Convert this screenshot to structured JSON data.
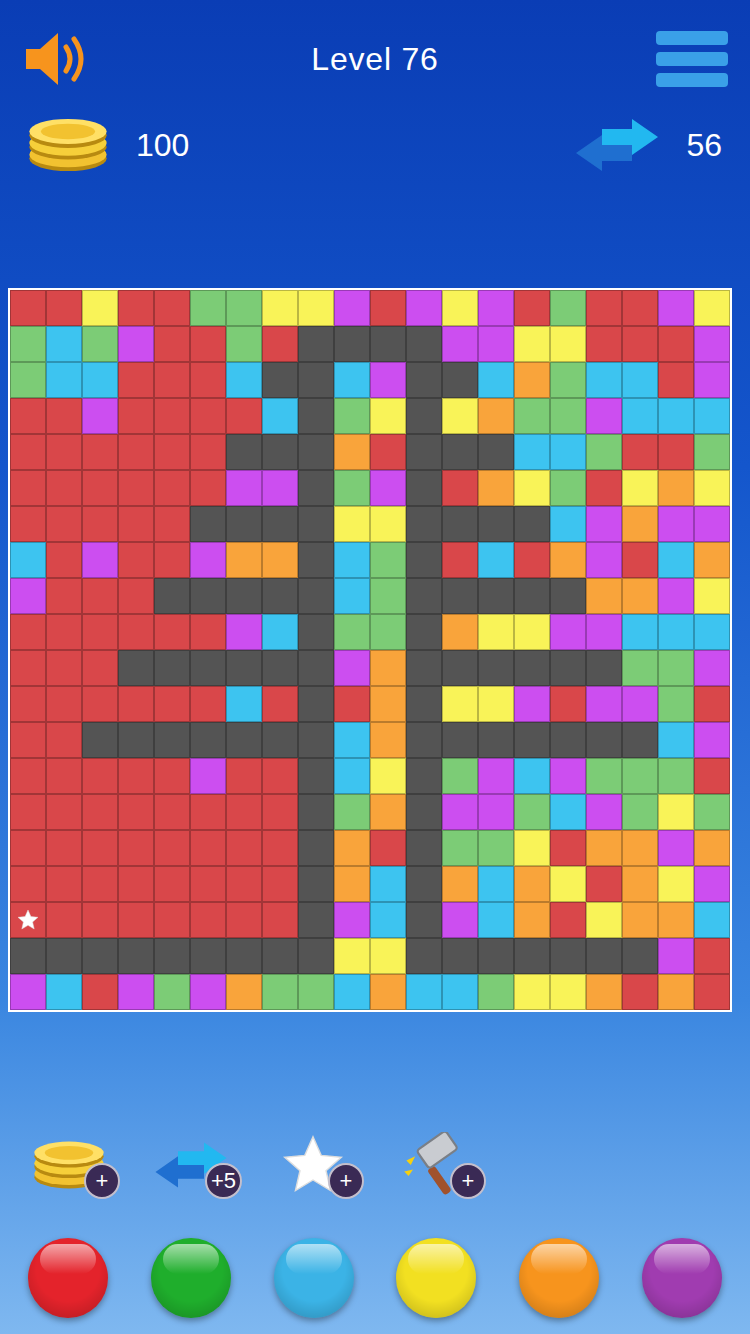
{
  "header": {
    "title": "Level 76",
    "coins": "100",
    "moves": "56"
  },
  "board": {
    "palette": [
      {
        "code": "R",
        "color": "#d9474a"
      },
      {
        "code": "G",
        "color": "#7ccc76"
      },
      {
        "code": "B",
        "color": "#3dc4f0"
      },
      {
        "code": "Y",
        "color": "#f9f358"
      },
      {
        "code": "O",
        "color": "#f9a43b"
      },
      {
        "code": "P",
        "color": "#cc4ef0"
      },
      {
        "code": "K",
        "color": "#545454"
      }
    ],
    "rows": [
      "RRYRRGGYYPRPYPRGRRPY",
      "GBGPRRGRKKKKPPYYRRRP",
      "GBBRRRBKKBPKKBOGBBRP",
      "RRPRRRRBKGYKYOGGPBBB",
      "RRRRRRKKKORKKKBBGRRG",
      "RRRRRRPPKGPKROYGRYOY",
      "RRRRRKKKKYYKKKKBPOPP",
      "BRPRRPOOKBGKRBROPRBO",
      "PRRRKKKKKBGKKKKKOOPY",
      "RRRRRRPBKGGKOYYPPBBB",
      "RRRKKKKKKPOKKKKKKGGP",
      "RRRRRRBRKROKYYPRPPGR",
      "RRKKKKKKKBOKKKKKKKBP",
      "RRRRRPRRKBYKGPBPGGGR",
      "RRRRRRRRKGOKPPGBPGYG",
      "RRRRRRRRKORKGGYROOPO",
      "RRRRRRRRKOBKOBOYROYP",
      "RRRRRRRRKPBKPBORYOOB",
      "KKKKKKKKKYYKKKKKKKPR",
      "PBRPGPOGGBOBBGYYOROR"
    ],
    "star": {
      "row": 17,
      "col": 0
    }
  },
  "powerups": [
    {
      "kind": "coins",
      "badge": "+"
    },
    {
      "kind": "moves",
      "badge": "+5"
    },
    {
      "kind": "star",
      "badge": "+"
    },
    {
      "kind": "hammer",
      "badge": "+"
    }
  ],
  "color_buttons": [
    {
      "color": "#e4232b"
    },
    {
      "color": "#1fae2c"
    },
    {
      "color": "#3bb3e6"
    },
    {
      "color": "#f2e021"
    },
    {
      "color": "#f7941d"
    },
    {
      "color": "#a03cb0"
    }
  ]
}
